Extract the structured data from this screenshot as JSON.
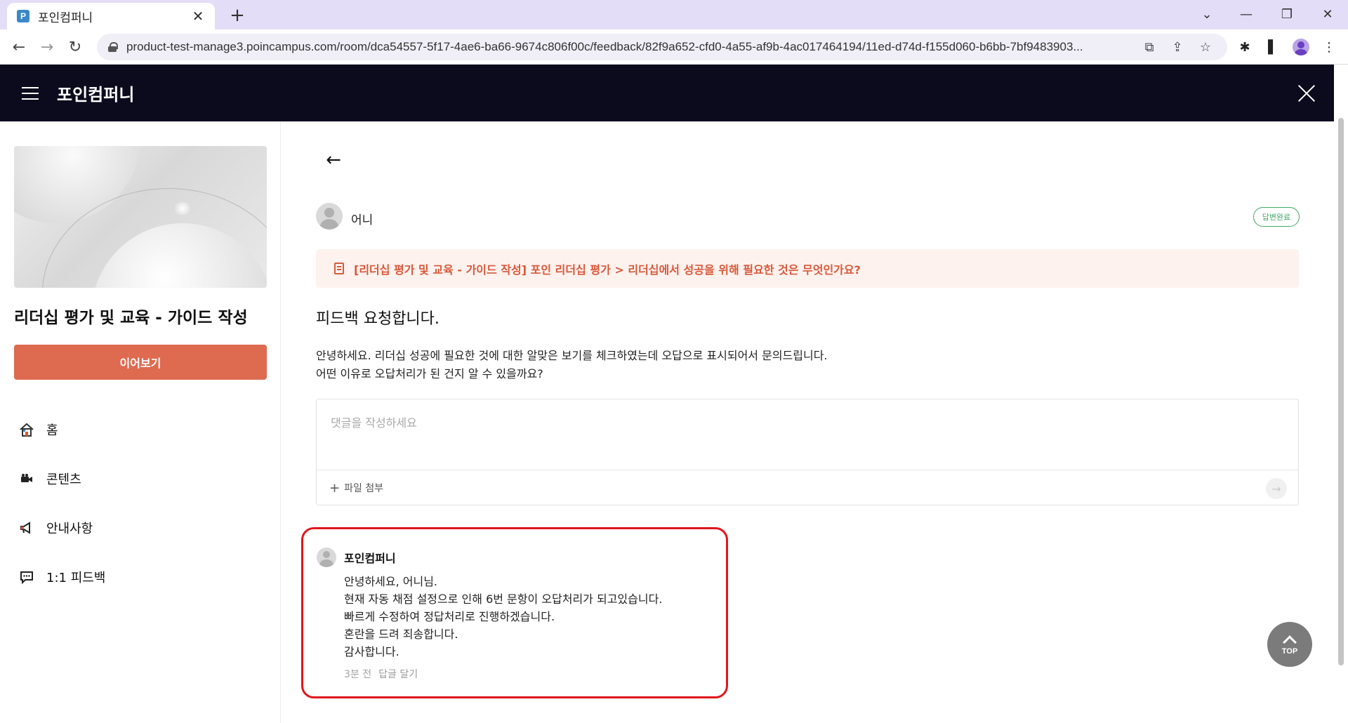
{
  "browser": {
    "tab_title": "포인컴퍼니",
    "tab_favicon": "P",
    "url": "product-test-manage3.poincampus.com/room/dca54557-5f17-4ae6-ba66-9674c806f00c/feedback/82f9a652-cfd0-4a55-af9b-4ac017464194/11ed-d74d-f155d060-b6bb-7bf9483903..."
  },
  "header": {
    "title": "포인컴퍼니"
  },
  "sidebar": {
    "course_title": "리더십 평가 및 교육 - 가이드 작성",
    "continue_label": "이어보기",
    "items": [
      {
        "label": "홈"
      },
      {
        "label": "콘텐츠"
      },
      {
        "label": "안내사항"
      },
      {
        "label": "1:1 피드백"
      }
    ]
  },
  "feedback": {
    "author": "어니",
    "status": "답변완료",
    "source": "[리더십 평가 및 교육 - 가이드 작성] 포인 리더십 평가 > 리더십에서 성공을 위해 필요한 것은 무엇인가요?",
    "title": "피드백 요청합니다.",
    "body_lines": [
      "안녕하세요. 리더십 성공에 필요한 것에 대한 알맞은 보기를 체크하였는데 오답으로 표시되어서 문의드립니다.",
      "어떤 이유로 오답처리가 된 건지 알 수 있을까요?"
    ]
  },
  "comment": {
    "placeholder": "댓글을 작성하세요",
    "attach_label": "파일 첨부"
  },
  "reply": {
    "author": "포인컴퍼니",
    "lines": [
      "안녕하세요, 어니님.",
      "현재 자동 채점 설정으로 인해 6번 문항이 오답처리가 되고있습니다.",
      "빠르게 수정하여 정답처리로 진행하겠습니다.",
      "혼란을 드려 죄송합니다.",
      "감사합니다."
    ],
    "time": "3분 전",
    "reply_label": "답글 달기"
  },
  "top_button": {
    "label": "TOP"
  },
  "colors": {
    "header_bg": "#0c0b1d",
    "accent": "#de6a50",
    "status_green": "#3fa866",
    "source_text": "#d9583a",
    "highlight": "#e2161b"
  }
}
